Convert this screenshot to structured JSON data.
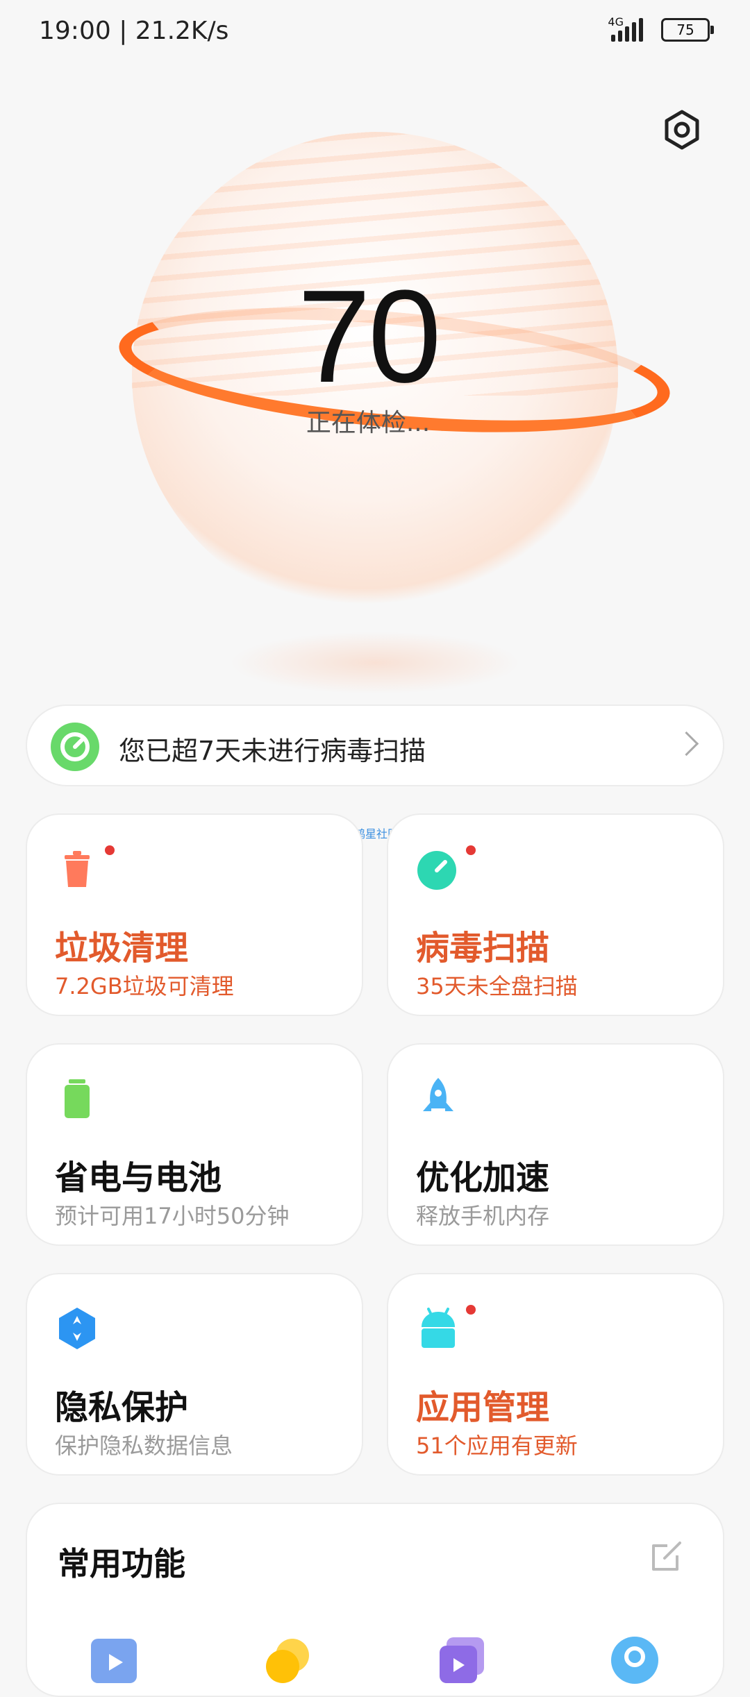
{
  "status_bar": {
    "time": "19:00 | 21.2K/s",
    "network": "4G",
    "battery": "75"
  },
  "hero": {
    "score": "70",
    "status": "正在体检..."
  },
  "alert": {
    "text": "您已超7天未进行病毒扫描",
    "icon": "shield-check-icon",
    "color": "#68d96a"
  },
  "watermark": "鸿星社区",
  "cards": [
    {
      "title": "垃圾清理",
      "subtitle": "7.2GB垃圾可清理",
      "icon": "trash-icon",
      "badge": true,
      "warn": true
    },
    {
      "title": "病毒扫描",
      "subtitle": "35天未全盘扫描",
      "icon": "virus-scan-icon",
      "badge": true,
      "warn": true
    },
    {
      "title": "省电与电池",
      "subtitle": "预计可用17小时50分钟",
      "icon": "battery-icon",
      "badge": false,
      "warn": false
    },
    {
      "title": "优化加速",
      "subtitle": "释放手机内存",
      "icon": "rocket-icon",
      "badge": false,
      "warn": false
    },
    {
      "title": "隐私保护",
      "subtitle": "保护隐私数据信息",
      "icon": "privacy-shield-icon",
      "badge": false,
      "warn": false
    },
    {
      "title": "应用管理",
      "subtitle": "51个应用有更新",
      "icon": "android-icon",
      "badge": true,
      "warn": true
    }
  ],
  "common_functions": {
    "title": "常用功能",
    "icons": [
      "video-icon",
      "coin-icon",
      "gallery-icon",
      "location-icon"
    ]
  },
  "colors": {
    "accent_orange": "#ff7a2e",
    "warn_text": "#e25a2c",
    "badge_red": "#e53935"
  }
}
